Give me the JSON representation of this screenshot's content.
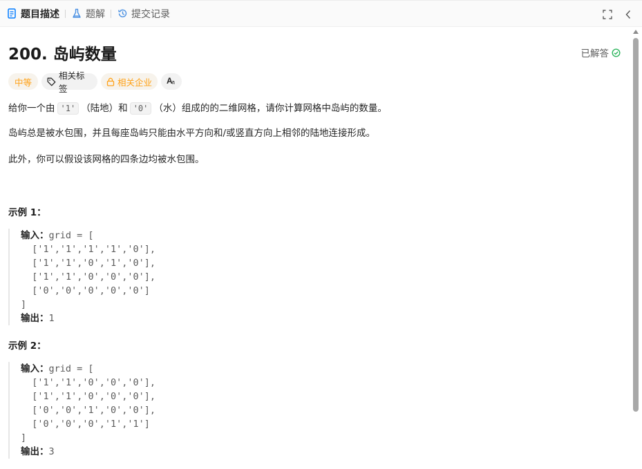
{
  "tabs": {
    "description": "题目描述",
    "solutions": "题解",
    "submissions": "提交记录"
  },
  "problem": {
    "title": "200. 岛屿数量",
    "status": "已解答"
  },
  "tags": {
    "difficulty": "中等",
    "topics": "相关标签",
    "companies": "相关企业"
  },
  "description": {
    "p1_a": "给你一个由",
    "p1_code1": "'1'",
    "p1_b": "（陆地）和",
    "p1_code2": "'0'",
    "p1_c": "（水）组成的的二维网格，请你计算网格中岛屿的数量。",
    "p2": "岛屿总是被水包围，并且每座岛屿只能由水平方向和/或竖直方向上相邻的陆地连接形成。",
    "p3": "此外，你可以假设该网格的四条边均被水包围。"
  },
  "examples": [
    {
      "title": "示例 1：",
      "input_label": "输入：",
      "input_first": "grid = [",
      "rows": [
        "  ['1','1','1','1','0'],",
        "  ['1','1','0','1','0'],",
        "  ['1','1','0','0','0'],",
        "  ['0','0','0','0','0']"
      ],
      "close": "]",
      "output_label": "输出：",
      "output_value": "1"
    },
    {
      "title": "示例 2：",
      "input_label": "输入：",
      "input_first": "grid = [",
      "rows": [
        "  ['1','1','0','0','0'],",
        "  ['1','1','0','0','0'],",
        "  ['0','0','1','0','0'],",
        "  ['0','0','0','1','1']"
      ],
      "close": "]",
      "output_label": "输出：",
      "output_value": "3"
    }
  ],
  "colors": {
    "accent_orange": "#ffa116",
    "solved_green": "#2db55d",
    "tab_blue": "#007aff"
  }
}
